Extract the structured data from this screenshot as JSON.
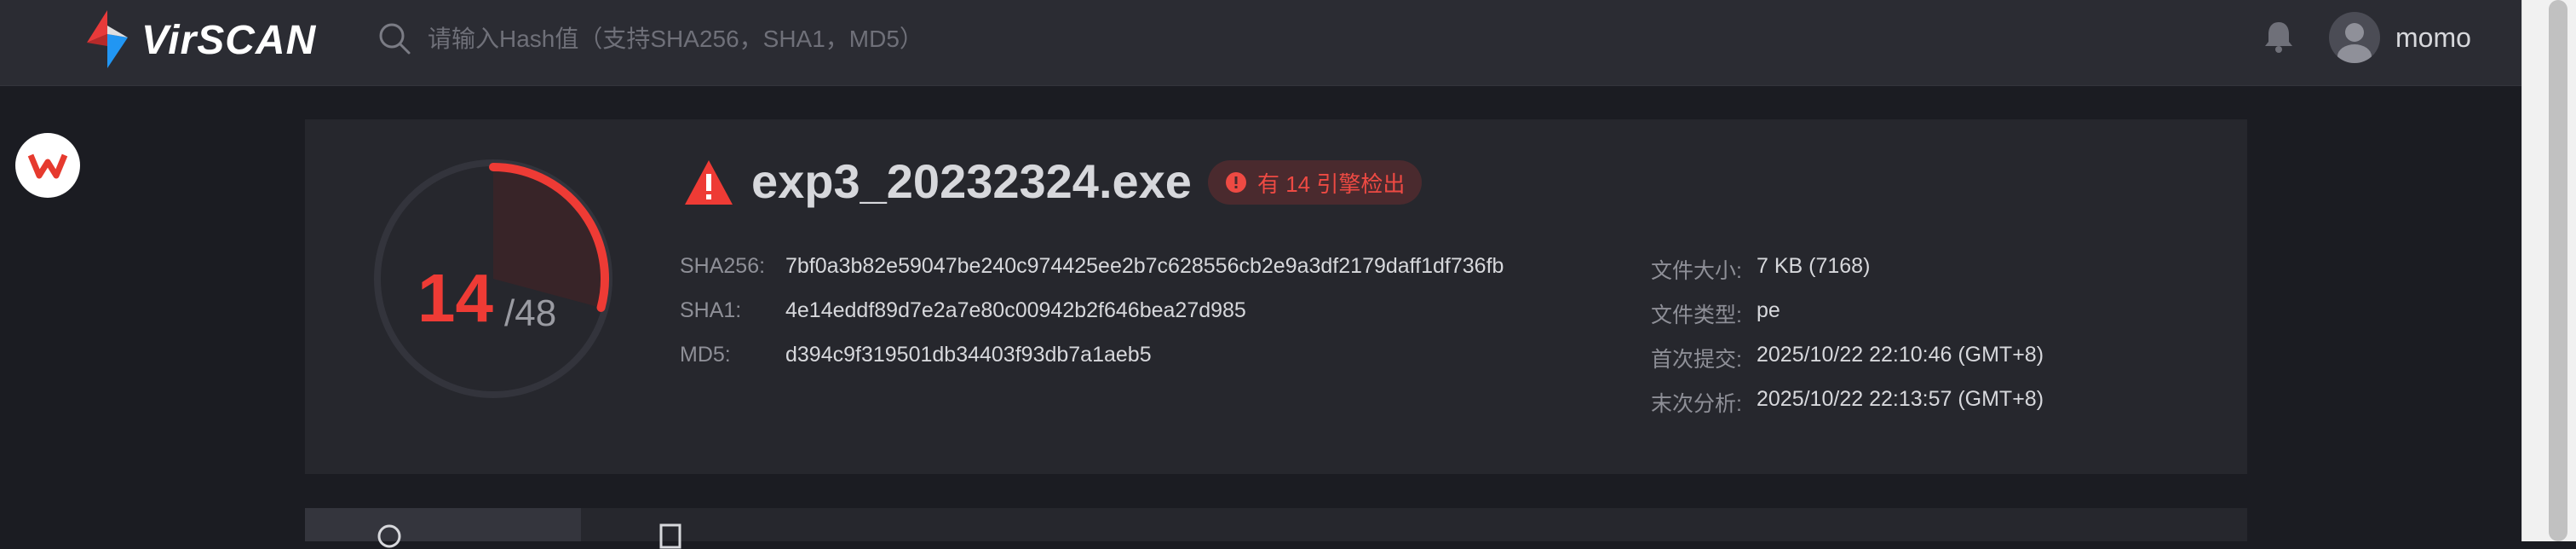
{
  "header": {
    "brand": "VirSCAN",
    "search_placeholder": "请输入Hash值（支持SHA256，SHA1，MD5）",
    "user_name": "momo"
  },
  "summary": {
    "detected_count": "14",
    "total_engines": "/48",
    "file_name": "exp3_20232324.exe",
    "detection_badge": "有 14 引擎检出",
    "hashes": [
      {
        "label": "SHA256:",
        "value": "7bf0a3b82e59047be240c974425ee2b7c628556cb2e9a3df2179daff1df736fb"
      },
      {
        "label": "SHA1:",
        "value": "4e14eddf89d7e2a7e80c00942b2f646bea27d985"
      },
      {
        "label": "MD5:",
        "value": "d394c9f319501db34403f93db7a1aeb5"
      }
    ],
    "meta": [
      {
        "label": "文件大小:",
        "value": "7 KB (7168)"
      },
      {
        "label": "文件类型:",
        "value": "pe"
      },
      {
        "label": "首次提交:",
        "value": "2025/10/22 22:10:46 (GMT+8)"
      },
      {
        "label": "末次分析:",
        "value": "2025/10/22 22:13:57 (GMT+8)"
      }
    ]
  },
  "colors": {
    "accent_red": "#ee3b35",
    "logo_red": "#e83a3a",
    "logo_blue": "#2196f3",
    "page_bg": "#1b1c22",
    "card_bg": "#26272d"
  },
  "icons": {
    "logo": "virscan-logo-icon",
    "search": "search-icon",
    "bell": "bell-icon",
    "avatar": "avatar-icon",
    "warning": "warning-icon",
    "badge": "alert-circle-icon",
    "float_app": "wps-app-icon"
  }
}
